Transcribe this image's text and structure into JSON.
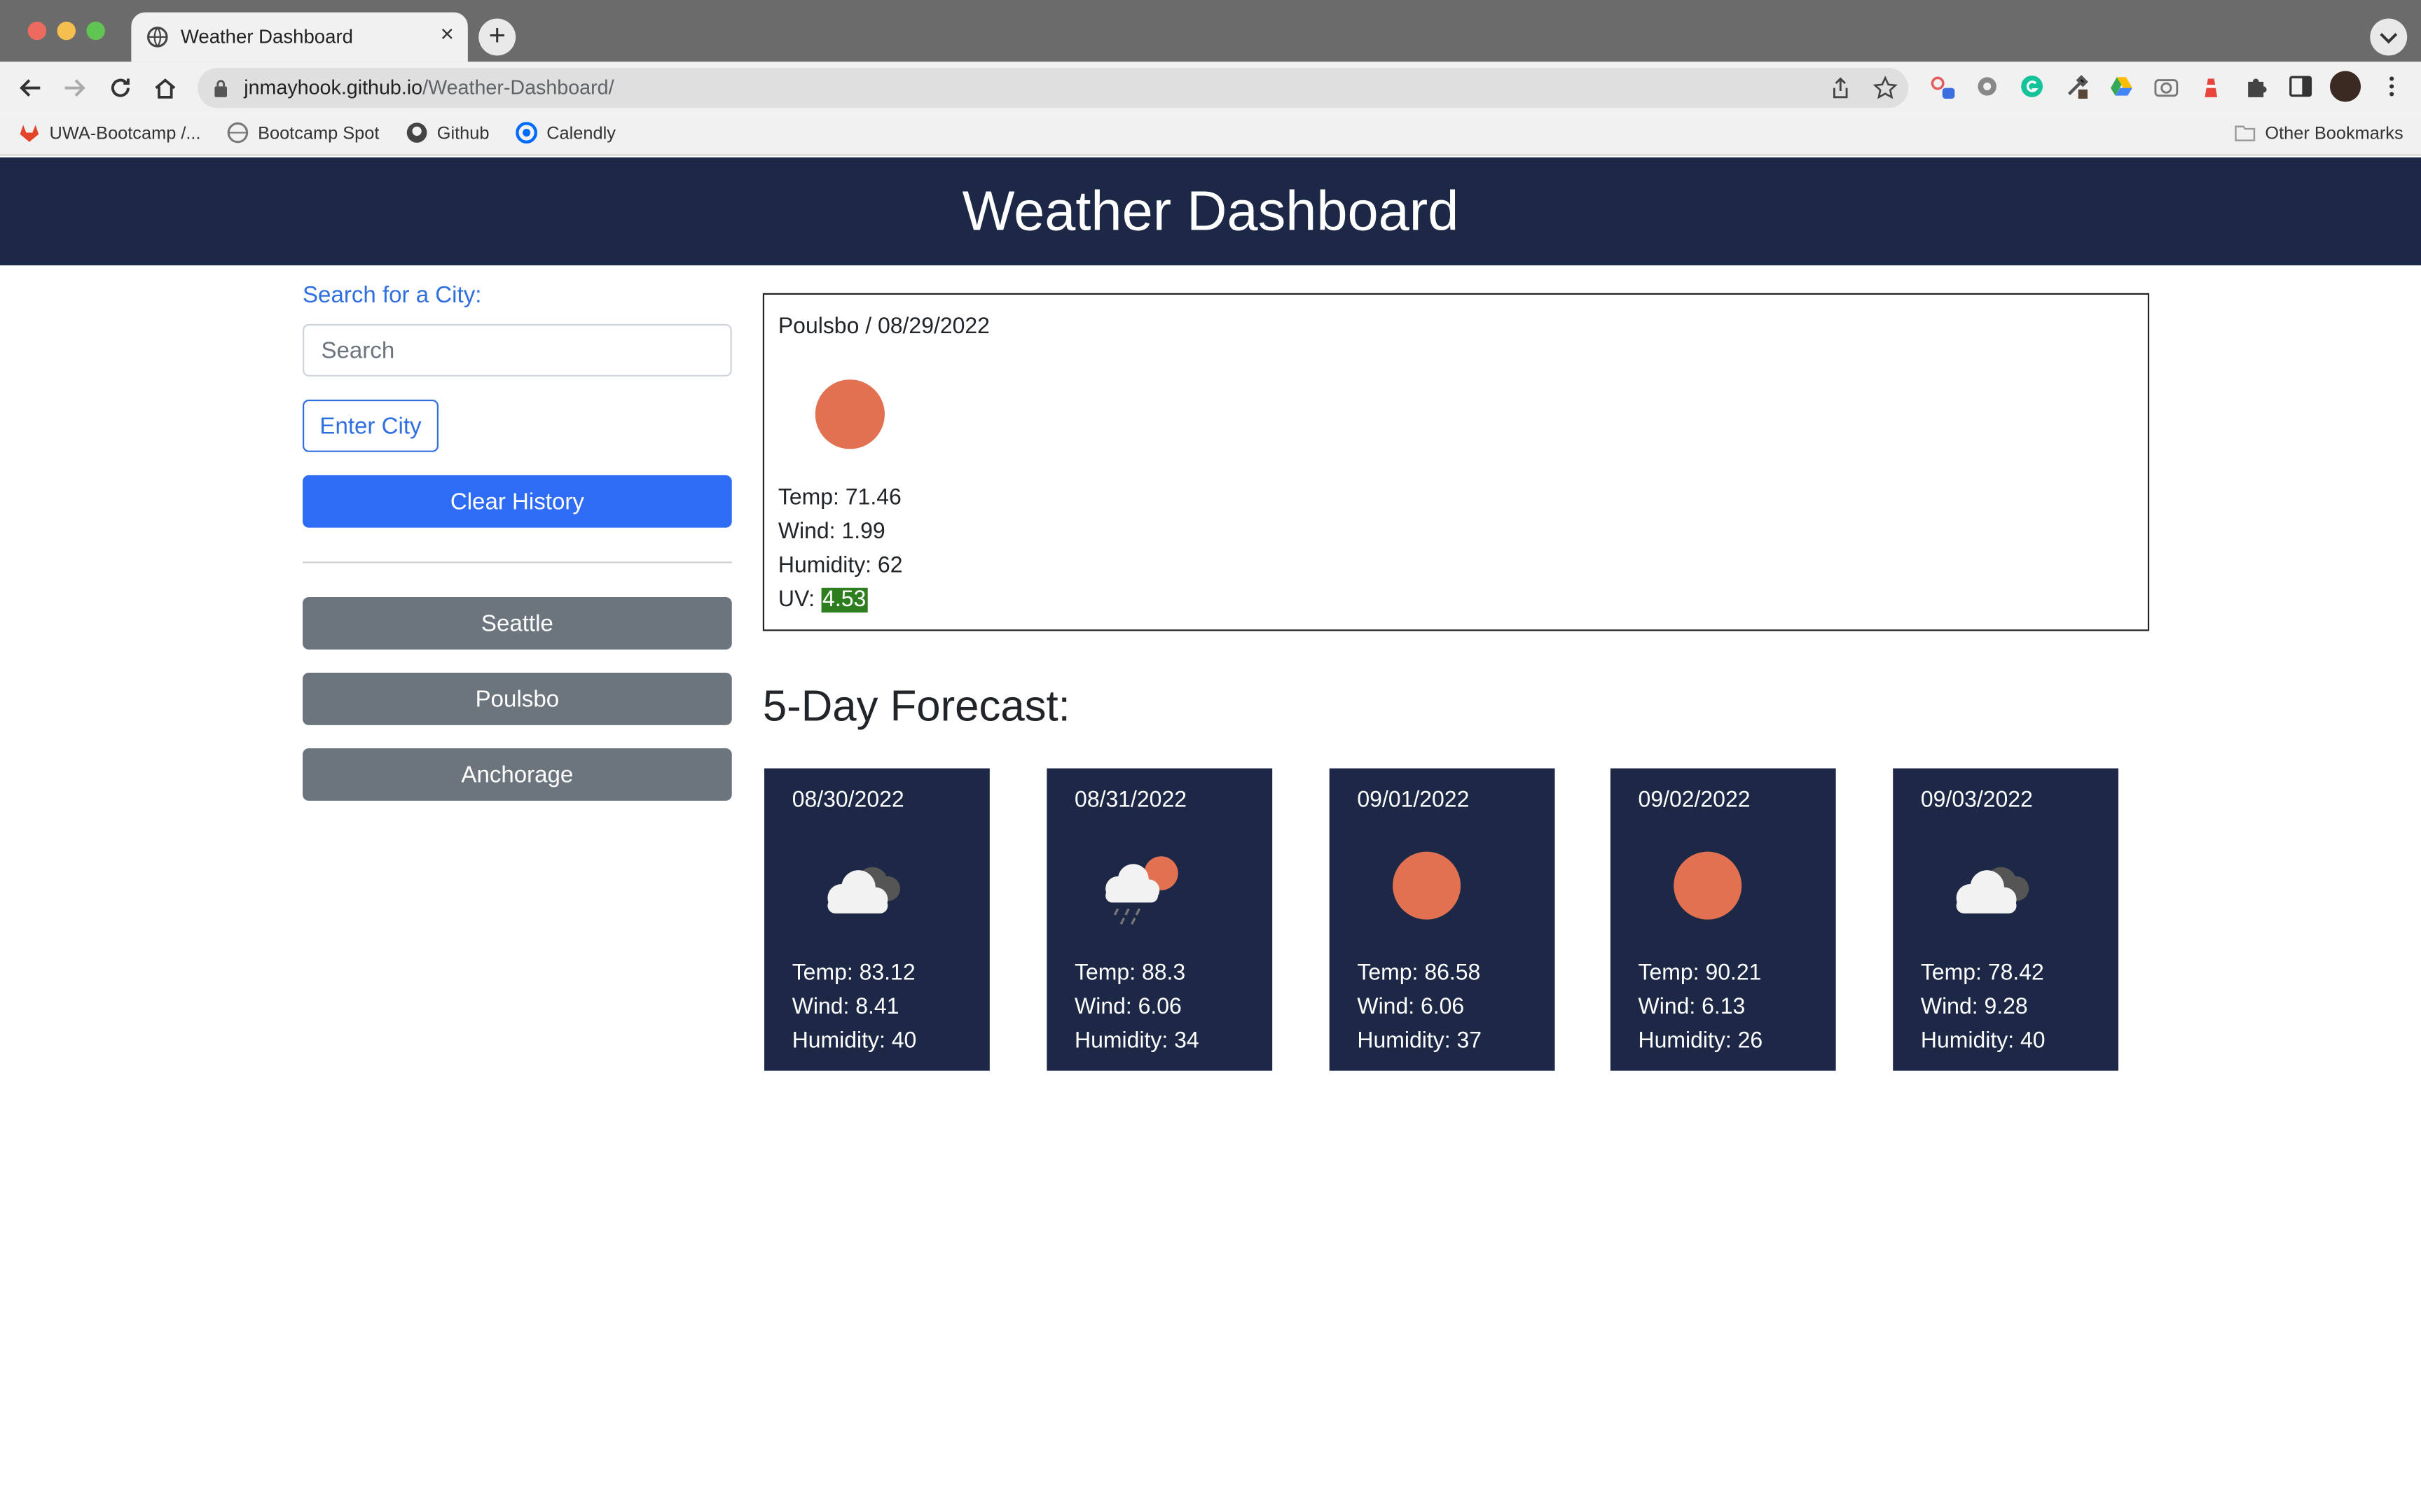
{
  "browser": {
    "tab_title": "Weather Dashboard",
    "url_host": "jnmayhook.github.io",
    "url_path": "/Weather-Dashboard/",
    "bookmarks": [
      "UWA-Bootcamp /...",
      "Bootcamp Spot",
      "Github",
      "Calendly"
    ],
    "other_bookmarks": "Other Bookmarks"
  },
  "header": {
    "title": "Weather Dashboard"
  },
  "sidebar": {
    "search_label": "Search for a City:",
    "search_placeholder": "Search",
    "enter_button": "Enter City",
    "clear_button": "Clear History",
    "history": [
      "Seattle",
      "Poulsbo",
      "Anchorage"
    ]
  },
  "current": {
    "heading": "Poulsbo / 08/29/2022",
    "icon": "sun-icon",
    "temp": "Temp: 71.46",
    "wind": "Wind: 1.99",
    "humidity": "Humidity: 62",
    "uv_label": "UV: ",
    "uv_value": "4.53",
    "uv_color": "#2e7d1f"
  },
  "forecast": {
    "title": "5-Day Forecast:",
    "days": [
      {
        "date": "08/30/2022",
        "icon": "cloudy-icon",
        "temp": "Temp: 83.12",
        "wind": "Wind: 8.41",
        "humidity": "Humidity: 40"
      },
      {
        "date": "08/31/2022",
        "icon": "sun-rain-icon",
        "temp": "Temp: 88.3",
        "wind": "Wind: 6.06",
        "humidity": "Humidity: 34"
      },
      {
        "date": "09/01/2022",
        "icon": "sun-icon",
        "temp": "Temp: 86.58",
        "wind": "Wind: 6.06",
        "humidity": "Humidity: 37"
      },
      {
        "date": "09/02/2022",
        "icon": "sun-icon",
        "temp": "Temp: 90.21",
        "wind": "Wind: 6.13",
        "humidity": "Humidity: 26"
      },
      {
        "date": "09/03/2022",
        "icon": "cloudy-icon",
        "temp": "Temp: 78.42",
        "wind": "Wind: 9.28",
        "humidity": "Humidity: 40"
      }
    ]
  },
  "colors": {
    "header_bg": "#1d2847",
    "sun": "#e27152",
    "primary": "#2e6cf6",
    "history_btn": "#6c757d"
  }
}
